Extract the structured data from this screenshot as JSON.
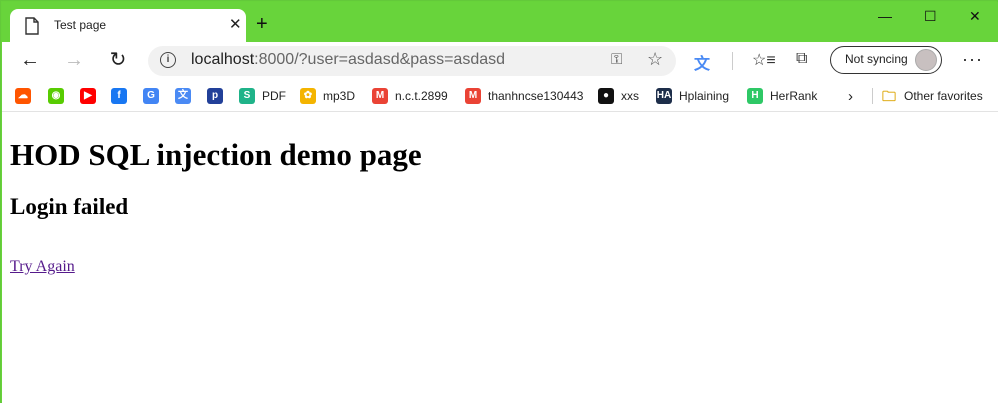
{
  "tab": {
    "title": "Test page"
  },
  "address": {
    "host": "localhost",
    "rest": ":8000/?user=asdasd&pass=asdasd"
  },
  "profile": {
    "sync_label": "Not syncing"
  },
  "bookmarks": [
    {
      "name": "soundcloud-bookmark",
      "label": "",
      "color": "#ff5500",
      "glyph": "☁"
    },
    {
      "name": "duolingo-bookmark",
      "label": "",
      "color": "#58cc02",
      "glyph": "◉"
    },
    {
      "name": "youtube-bookmark",
      "label": "",
      "color": "#ff0000",
      "glyph": "▶"
    },
    {
      "name": "facebook-bookmark",
      "label": "",
      "color": "#1877f2",
      "glyph": "f"
    },
    {
      "name": "google-bookmark",
      "label": "",
      "color": "#4285f4",
      "glyph": "G"
    },
    {
      "name": "google-translate-bookmark",
      "label": "",
      "color": "#4a8af4",
      "glyph": "文"
    },
    {
      "name": "pandora-bookmark",
      "label": "",
      "color": "#224099",
      "glyph": "p"
    },
    {
      "name": "pdf-bookmark",
      "label": "PDF",
      "color": "#1fb389",
      "glyph": "S"
    },
    {
      "name": "mp3d-bookmark",
      "label": "mp3D",
      "color": "#f4b400",
      "glyph": "✿"
    },
    {
      "name": "gmail-nct-bookmark",
      "label": "n.c.t.2899",
      "color": "#ea4335",
      "glyph": "M"
    },
    {
      "name": "gmail-thanh-bookmark",
      "label": "thanhncse130443",
      "color": "#ea4335",
      "glyph": "M"
    },
    {
      "name": "github-xxs-bookmark",
      "label": "xxs",
      "color": "#111111",
      "glyph": "●"
    },
    {
      "name": "hplaining-bookmark",
      "label": "Hplaining",
      "color": "#1d2e4a",
      "glyph": "HA"
    },
    {
      "name": "herrank-bookmark",
      "label": "HerRank",
      "color": "#2ec866",
      "glyph": "H"
    }
  ],
  "other_favorites": "Other favorites",
  "page": {
    "heading": "HOD SQL injection demo page",
    "status": "Login failed",
    "link": "Try Again"
  }
}
